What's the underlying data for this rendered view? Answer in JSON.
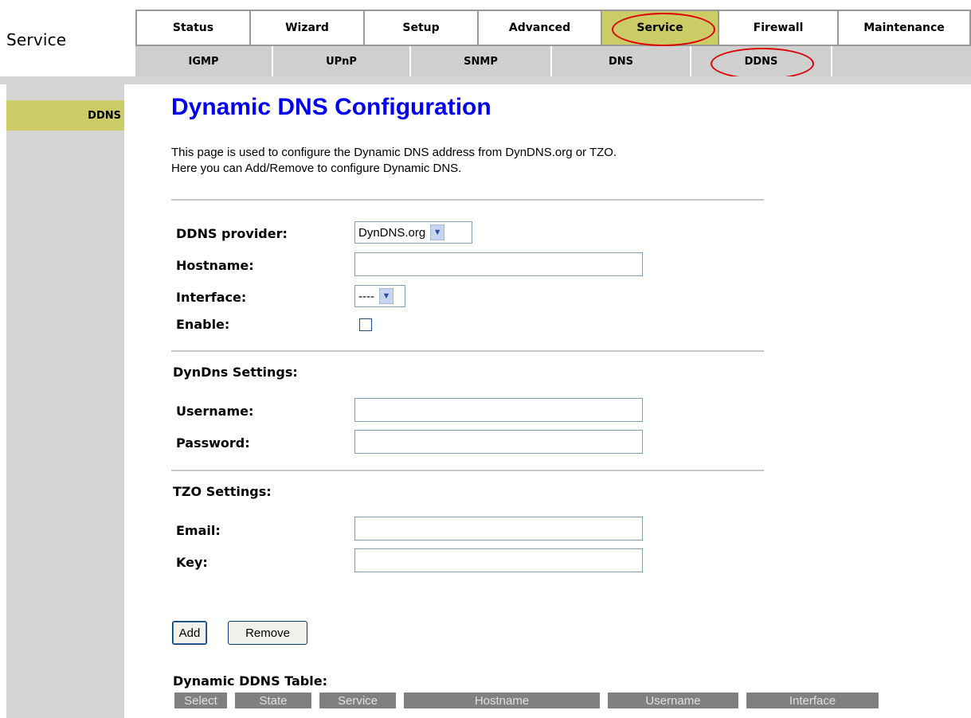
{
  "section_title": "Service",
  "main_tabs": [
    {
      "label": "Status",
      "active": false
    },
    {
      "label": "Wizard",
      "active": false
    },
    {
      "label": "Setup",
      "active": false
    },
    {
      "label": "Advanced",
      "active": false
    },
    {
      "label": "Service",
      "active": true
    },
    {
      "label": "Firewall",
      "active": false
    },
    {
      "label": "Maintenance",
      "active": false
    }
  ],
  "sub_tabs": [
    {
      "label": "IGMP",
      "active": false
    },
    {
      "label": "UPnP",
      "active": false
    },
    {
      "label": "SNMP",
      "active": false
    },
    {
      "label": "DNS",
      "active": false
    },
    {
      "label": "DDNS",
      "active": true
    },
    {
      "label": "",
      "active": false
    }
  ],
  "sidebar": {
    "items": [
      {
        "label": "DDNS",
        "active": true
      }
    ]
  },
  "page": {
    "title": "Dynamic DNS Configuration",
    "description_line1": "This page is used to configure the Dynamic DNS address from DynDNS.org or TZO.",
    "description_line2": "Here you can Add/Remove to configure Dynamic DNS."
  },
  "form": {
    "provider_label": "DDNS provider:",
    "provider_value": "DynDNS.org",
    "hostname_label": "Hostname:",
    "hostname_value": "",
    "interface_label": "Interface:",
    "interface_value": "----",
    "enable_label": "Enable:",
    "enable_checked": false,
    "dyndns_heading": "DynDns Settings:",
    "username_label": "Username:",
    "username_value": "",
    "password_label": "Password:",
    "password_value": "",
    "tzo_heading": "TZO Settings:",
    "email_label": "Email:",
    "email_value": "",
    "key_label": "Key:",
    "key_value": ""
  },
  "buttons": {
    "add": "Add",
    "remove": "Remove"
  },
  "table": {
    "heading": "Dynamic DDNS Table:",
    "columns": [
      "Select",
      "State",
      "Service",
      "Hostname",
      "Username",
      "Interface"
    ]
  },
  "colors": {
    "active_tab": "#cccc66",
    "title": "#0000ee",
    "highlight_ring": "#dd0000",
    "table_header": "#808080"
  }
}
